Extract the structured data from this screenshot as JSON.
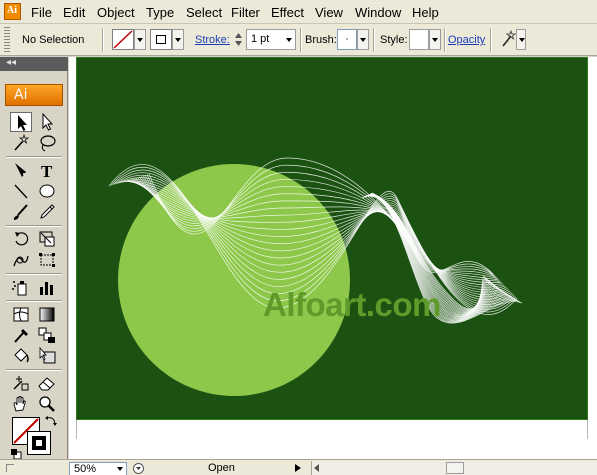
{
  "menubar": {
    "items": [
      "File",
      "Edit",
      "Object",
      "Type",
      "Select",
      "Filter",
      "Effect",
      "View",
      "Window",
      "Help"
    ]
  },
  "controlbar": {
    "selection_label": "No Selection",
    "stroke_label": "Stroke:",
    "stroke_weight": "1 pt",
    "brush_label": "Brush:",
    "brush_value": "·",
    "style_label": "Style:",
    "opacity_label": "Opacity"
  },
  "toolbox": {
    "collapse_glyph": "◂◂",
    "logo": "Ai",
    "tools": [
      "selection-tool",
      "direct-selection-tool",
      "magic-wand-tool",
      "lasso-tool",
      "pen-tool",
      "type-tool",
      "line-segment-tool",
      "ellipse-tool",
      "paintbrush-tool",
      "pencil-tool",
      "rotate-tool",
      "scale-tool",
      "warp-tool",
      "free-transform-tool",
      "symbol-sprayer-tool",
      "column-graph-tool",
      "mesh-tool",
      "gradient-tool",
      "eyedropper-tool",
      "blend-tool",
      "live-paint-bucket-tool",
      "live-paint-selection-tool",
      "slice-tool",
      "eraser-tool",
      "hand-tool",
      "zoom-tool"
    ]
  },
  "document": {
    "canvas_color": "#1b5212",
    "circle_color": "#8dc84a",
    "watermark": "Alfoart.com"
  },
  "statusbar": {
    "zoom": "50%",
    "status": "Open"
  }
}
